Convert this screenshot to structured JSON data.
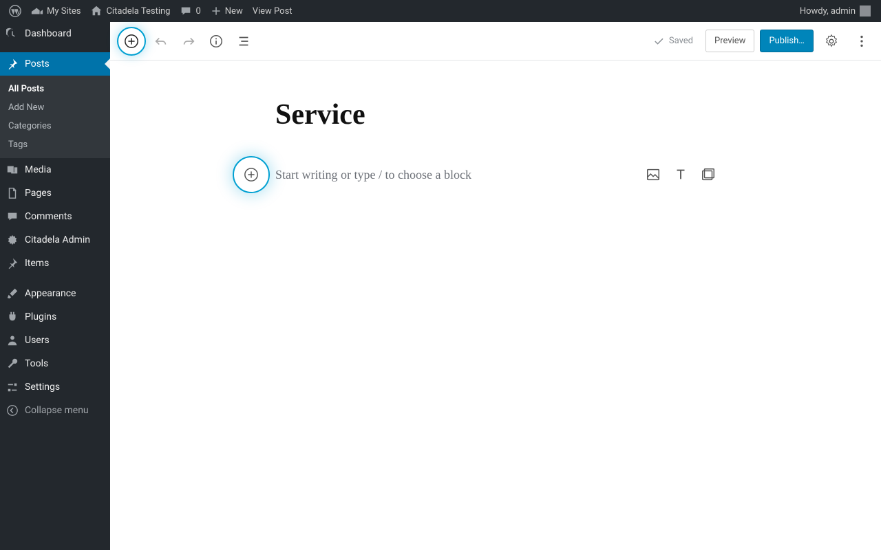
{
  "adminbar": {
    "my_sites": "My Sites",
    "site_name": "Citadela Testing",
    "comment_count": "0",
    "new_label": "New",
    "view_post": "View Post",
    "howdy": "Howdy, admin"
  },
  "sidebar": {
    "dashboard": "Dashboard",
    "posts": "Posts",
    "submenu": {
      "all_posts": "All Posts",
      "add_new": "Add New",
      "categories": "Categories",
      "tags": "Tags"
    },
    "media": "Media",
    "pages": "Pages",
    "comments": "Comments",
    "citadela_admin": "Citadela Admin",
    "items": "Items",
    "appearance": "Appearance",
    "plugins": "Plugins",
    "users": "Users",
    "tools": "Tools",
    "settings": "Settings",
    "collapse": "Collapse menu"
  },
  "editor": {
    "saved": "Saved",
    "preview": "Preview",
    "publish": "Publish…",
    "post_title": "Service",
    "placeholder": "Start writing or type / to choose a block"
  }
}
